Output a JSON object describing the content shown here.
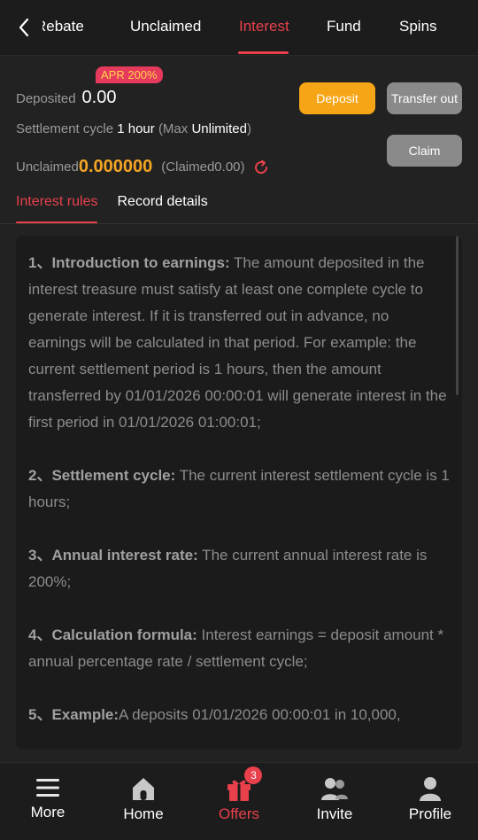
{
  "top_tabs": [
    {
      "label": "Rebate"
    },
    {
      "label": "Unclaimed"
    },
    {
      "label": "Interest"
    },
    {
      "label": "Fund"
    },
    {
      "label": "Spins"
    }
  ],
  "summary": {
    "deposited_label": "Deposited",
    "deposited_value": "0.00",
    "apr_badge": "APR 200%",
    "cycle_label": "Settlement cycle",
    "cycle_value": "1 hour",
    "max_prefix": "(Max",
    "max_value": "Unlimited",
    "max_suffix": ")",
    "unclaimed_label": "Unclaimed",
    "unclaimed_value": "0.000000",
    "claimed_text": "(Claimed0.00)",
    "deposit_button": "Deposit",
    "transfer_button": "Transfer out",
    "claim_button": "Claim"
  },
  "sub_tabs": [
    {
      "label": "Interest rules"
    },
    {
      "label": "Record details"
    }
  ],
  "rules": [
    {
      "title": "1、Introduction to earnings:",
      "text": " The amount deposited in the interest treasure must satisfy at least one complete cycle to generate interest. If it is transferred out in advance, no earnings will be calculated in that period. For example: the current settlement period is 1 hours, then the amount transferred by 01/01/2026 00:00:01 will generate interest in the first period in 01/01/2026 01:00:01;"
    },
    {
      "title": "2、Settlement cycle:",
      "text": " The current interest settlement cycle is 1 hours;"
    },
    {
      "title": "3、Annual interest rate:",
      "text": " The current annual interest rate is 200%;"
    },
    {
      "title": "4、Calculation formula:",
      "text": " Interest earnings = deposit amount * annual percentage rate / settlement cycle;"
    },
    {
      "title": "5、Example:",
      "text": "A deposits 01/01/2026 00:00:01 in 10,000,"
    }
  ],
  "bottom_nav": [
    {
      "label": "More",
      "icon": "menu-icon"
    },
    {
      "label": "Home",
      "icon": "home-icon"
    },
    {
      "label": "Offers",
      "icon": "gift-icon",
      "badge": "3"
    },
    {
      "label": "Invite",
      "icon": "users-icon"
    },
    {
      "label": "Profile",
      "icon": "user-icon"
    }
  ],
  "colors": {
    "accent": "#e8414b",
    "gold": "#f5a524",
    "background": "#222222"
  }
}
